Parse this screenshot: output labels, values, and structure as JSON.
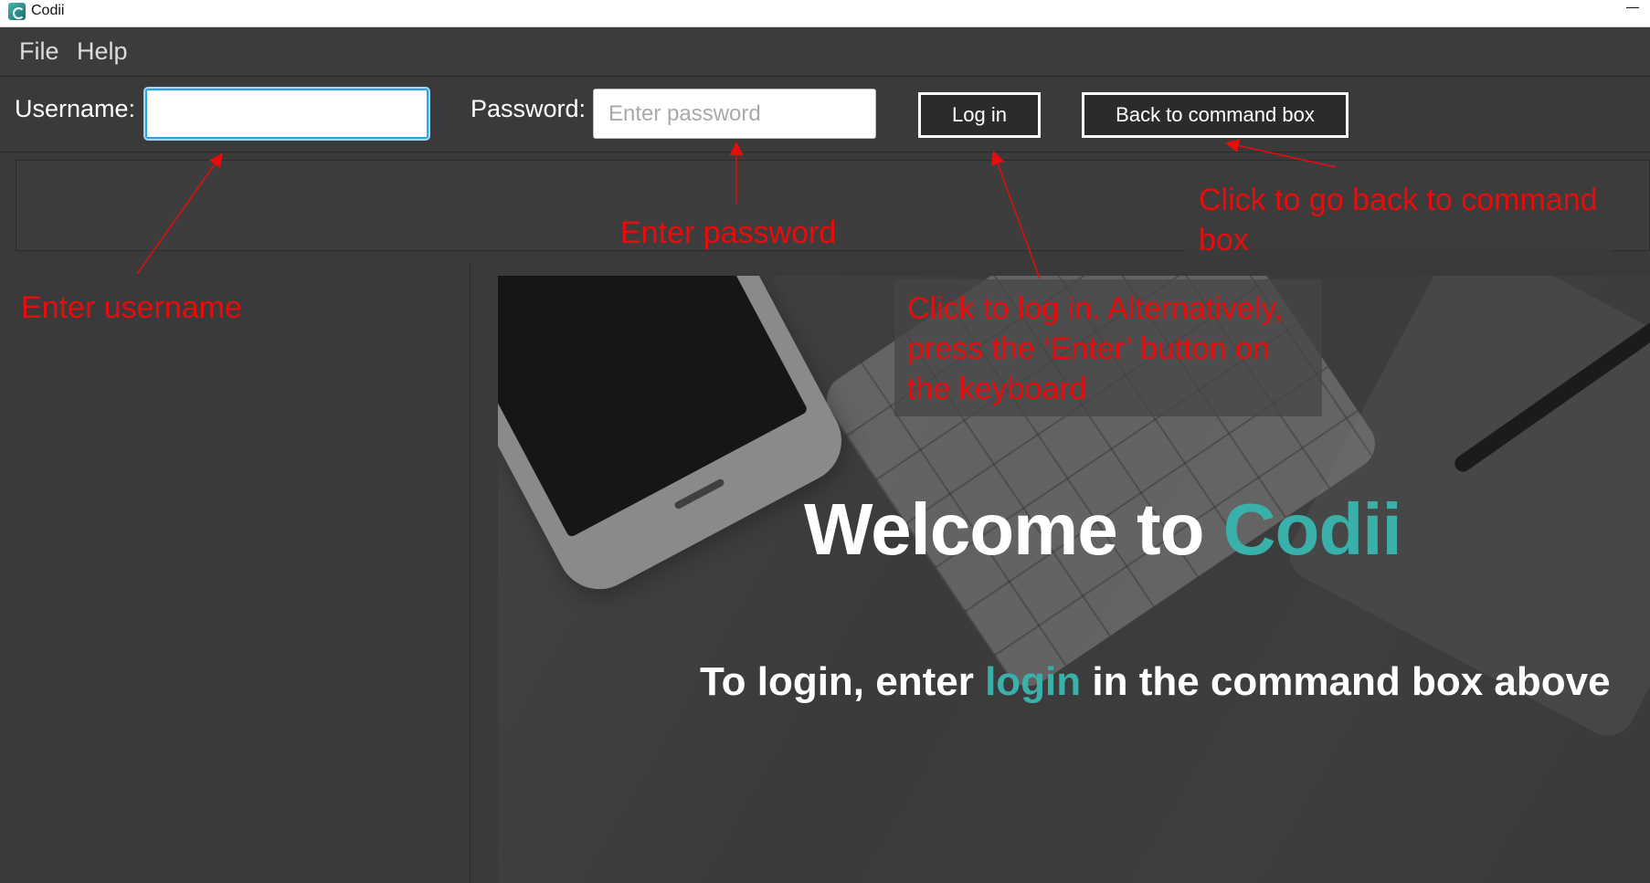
{
  "window": {
    "title": "Codii"
  },
  "menu": {
    "items": [
      "File",
      "Help"
    ]
  },
  "login": {
    "username_label": "Username:",
    "username_value": "",
    "password_label": "Password:",
    "password_placeholder": "Enter password",
    "login_button": "Log in",
    "back_button": "Back to command box"
  },
  "welcome": {
    "title_prefix": "Welcome to ",
    "title_brand": "Codii",
    "subtitle_prefix": "To login, enter ",
    "subtitle_keyword": "login",
    "subtitle_suffix": " in the command box above"
  },
  "annotations": {
    "username": "Enter username",
    "password": "Enter password",
    "login_line1": "Click to log in. Alternatively,",
    "login_line2": "press the ‘Enter’ button on",
    "login_line3": "the keyboard",
    "back_line1": "Click to go back to command",
    "back_line2": "box"
  },
  "colors": {
    "accent": "#3ab0ab",
    "annotation": "#e80c0c",
    "focus_ring": "#2aa6e8",
    "background": "#3a3a3a"
  },
  "icons": {
    "app": "codii-app-icon",
    "minimize": "minimize-icon"
  }
}
